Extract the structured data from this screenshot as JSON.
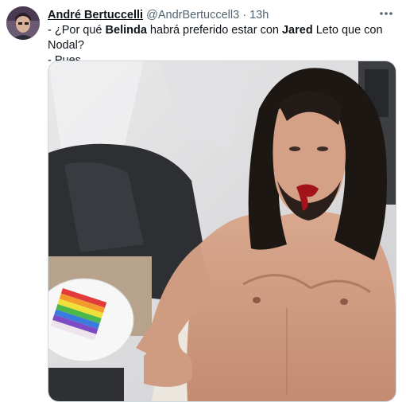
{
  "tweet": {
    "author_name": "André Bertuccelli",
    "handle": "@AndrBertuccell3",
    "separator": "·",
    "time": "13h",
    "more_icon": "more-horizontal-icon",
    "lines": [
      {
        "prefix": "- ¿Por qué ",
        "bold1": "Belinda",
        "mid": " habrá preferido estar con ",
        "bold2": "Jared",
        "suffix": " Leto que con Nodal?"
      },
      {
        "text": "- Pues..."
      }
    ],
    "media": {
      "description_icon": "photo-shirtless-man-with-cake-icon"
    }
  }
}
